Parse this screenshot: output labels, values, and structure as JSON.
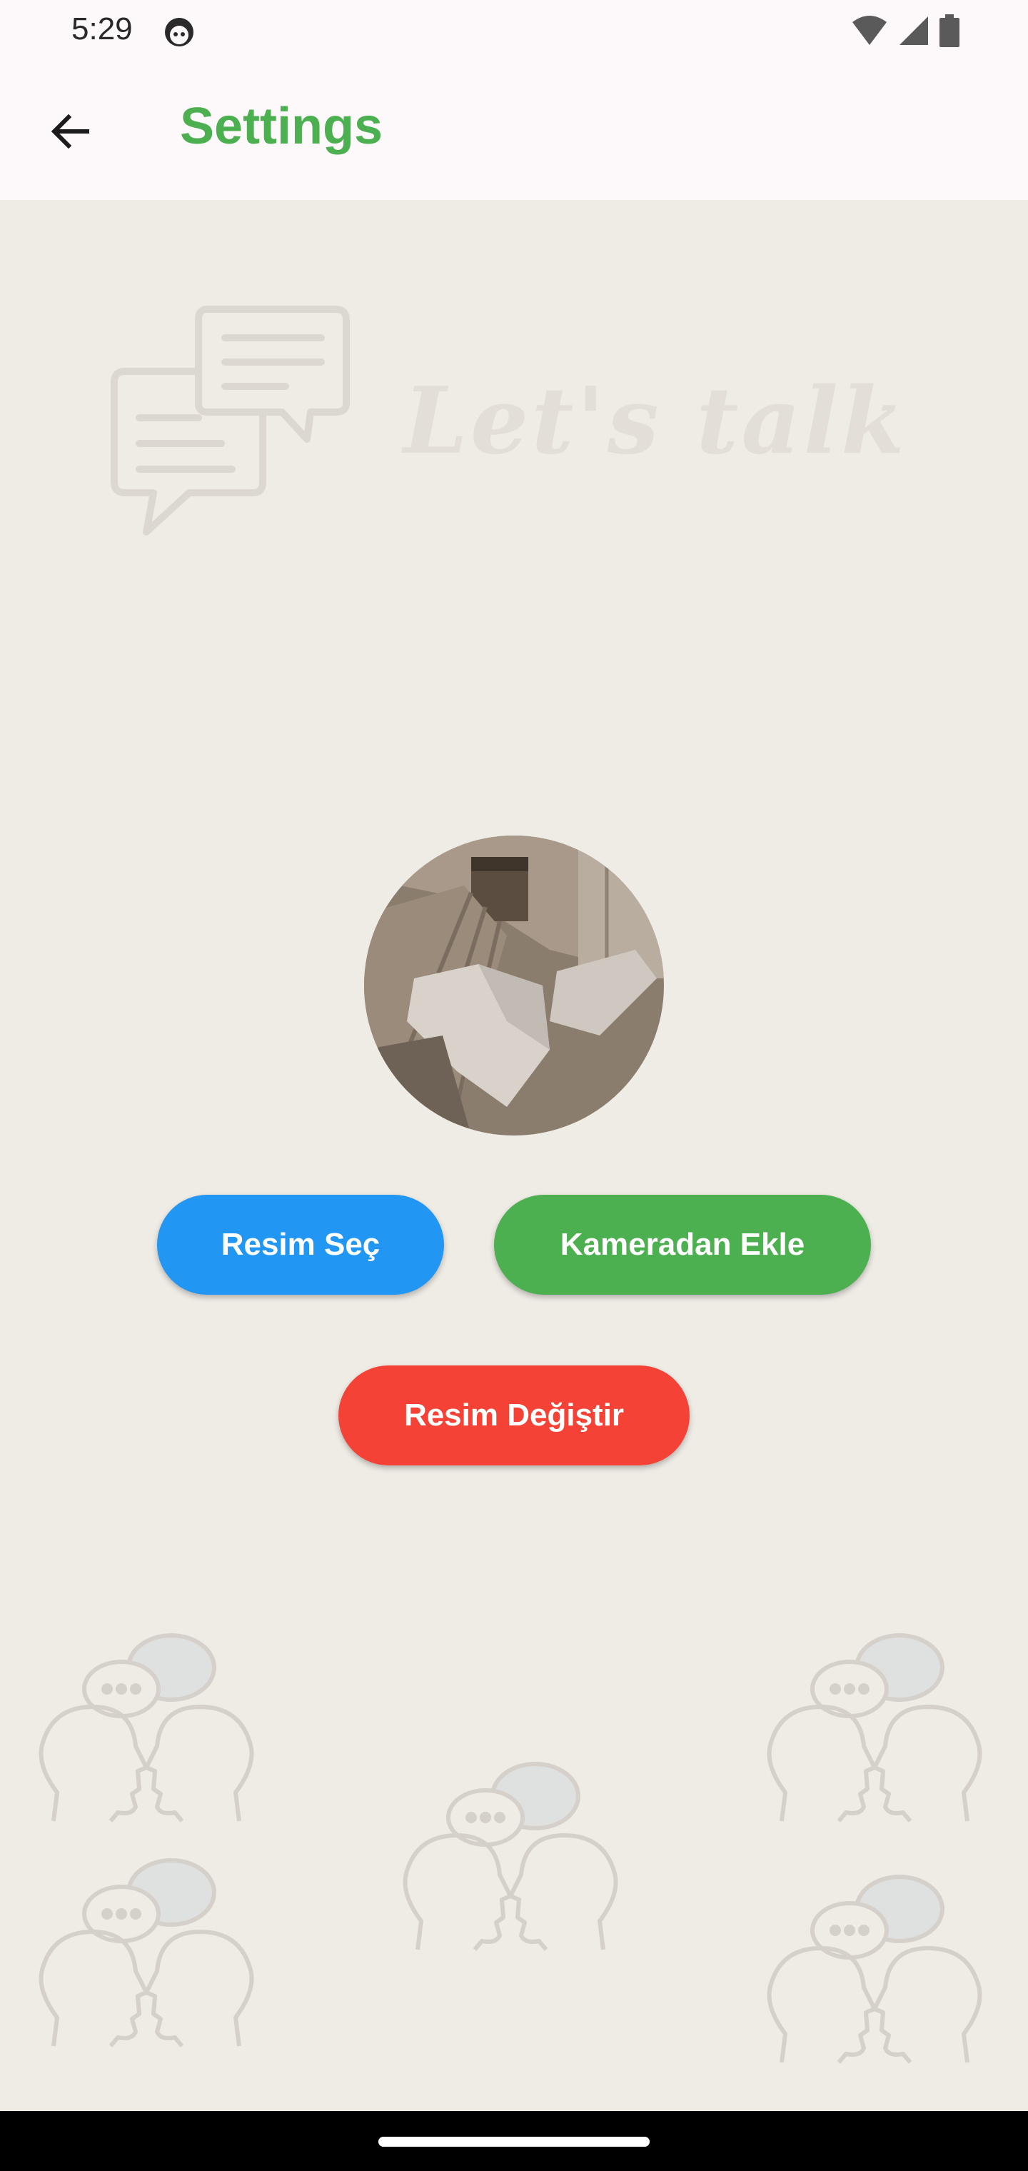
{
  "status_bar": {
    "time": "5:29",
    "icons": [
      "android-face-icon",
      "wifi-icon",
      "signal-icon",
      "battery-icon"
    ]
  },
  "app_bar": {
    "title": "Settings",
    "back_icon": "arrow-back-icon",
    "title_color": "#4caf50"
  },
  "brand": {
    "text": "Let's talk",
    "icon": "chat-bubbles-icon"
  },
  "profile": {
    "avatar_icon": "profile-photo"
  },
  "buttons": {
    "pick_image": "Resim Seç",
    "camera_add": "Kameradan Ekle",
    "change_image": "Resim Değiştir"
  },
  "colors": {
    "background": "#efebe5",
    "pick_button": "#2196f3",
    "camera_button": "#4caf50",
    "change_button": "#f44336"
  },
  "decorations": {
    "icon": "talking-heads-icon"
  }
}
